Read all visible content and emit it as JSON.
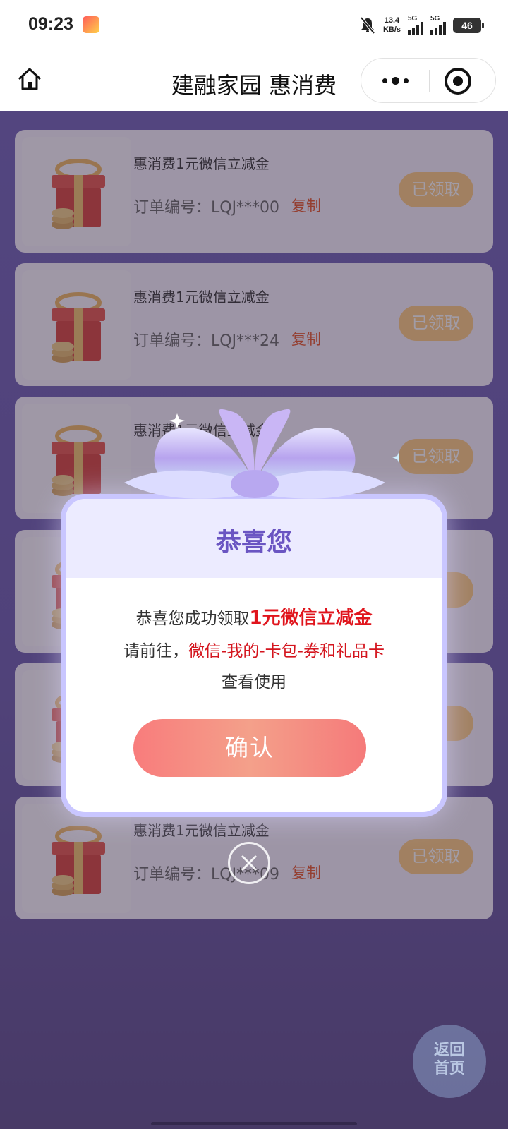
{
  "status_bar": {
    "time": "09:23",
    "net_speed_value": "13.4",
    "net_speed_unit": "KB/s",
    "network1": "5G",
    "network2": "5G",
    "battery": "46"
  },
  "nav": {
    "title": "建融家园 惠消费"
  },
  "cards": [
    {
      "name": "惠消费1元微信立减金",
      "order": "订单编号：LQJ***00",
      "copy": "复制",
      "status": "已领取"
    },
    {
      "name": "惠消费1元微信立减金",
      "order": "订单编号：LQJ***24",
      "copy": "复制",
      "status": "已领取"
    },
    {
      "name": "惠消费1元微信立减金",
      "order": "",
      "copy": "",
      "status": "已领取"
    },
    {
      "name": "",
      "order": "",
      "copy": "",
      "status": ""
    },
    {
      "name": "",
      "order": "",
      "copy": "",
      "status": ""
    },
    {
      "name": "惠消费1元微信立减金",
      "order": "订单编号：LQJ***09",
      "copy": "复制",
      "status": "已领取"
    }
  ],
  "dialog": {
    "title": "恭喜您",
    "line1_prefix": "恭喜您成功领取",
    "line1_highlight": "1元微信立减金",
    "line2_prefix": "请前往，",
    "line2_highlight": "微信-我的-卡包-券和礼品卡",
    "line3": "查看使用",
    "confirm_label": "确认"
  },
  "return_button": {
    "line1": "返回",
    "line2": "首页"
  },
  "colors": {
    "page_background": "#6a5aae",
    "card_background": "#f7f2ff",
    "claimed_button": "#ffcc80",
    "copy_link": "#e85427",
    "dialog_title": "#6a55c2",
    "highlight_red": "#e0141c",
    "confirm_button": "#f68a82"
  },
  "icons": {
    "home": "home-icon",
    "more": "more-dots-icon",
    "close_miniprogram": "target-close-icon",
    "gift": "gift-box-icon",
    "dialog_close": "close-circle-icon",
    "bow": "ribbon-bow-icon"
  }
}
